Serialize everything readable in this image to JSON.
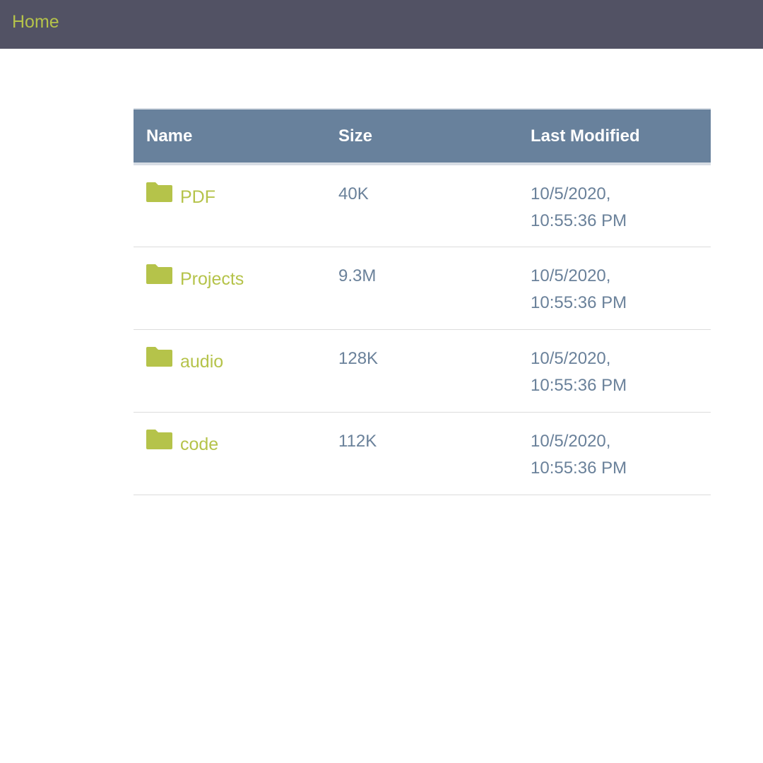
{
  "topbar": {
    "home_label": "Home",
    "background": "#525264",
    "link_color": "#b5c34a"
  },
  "table": {
    "headers": {
      "name": "Name",
      "size": "Size",
      "modified": "Last Modified"
    },
    "header_background": "#68819c",
    "rows": [
      {
        "name": "PDF",
        "icon": "folder-icon",
        "size": "40K",
        "modified_date": "10/5/2020,",
        "modified_time": "10:55:36 PM"
      },
      {
        "name": "Projects",
        "icon": "folder-icon",
        "size": "9.3M",
        "modified_date": "10/5/2020,",
        "modified_time": "10:55:36 PM"
      },
      {
        "name": "audio",
        "icon": "folder-icon",
        "size": "128K",
        "modified_date": "10/5/2020,",
        "modified_time": "10:55:36 PM"
      },
      {
        "name": "code",
        "icon": "folder-icon",
        "size": "112K",
        "modified_date": "10/5/2020,",
        "modified_time": "10:55:36 PM"
      }
    ]
  }
}
